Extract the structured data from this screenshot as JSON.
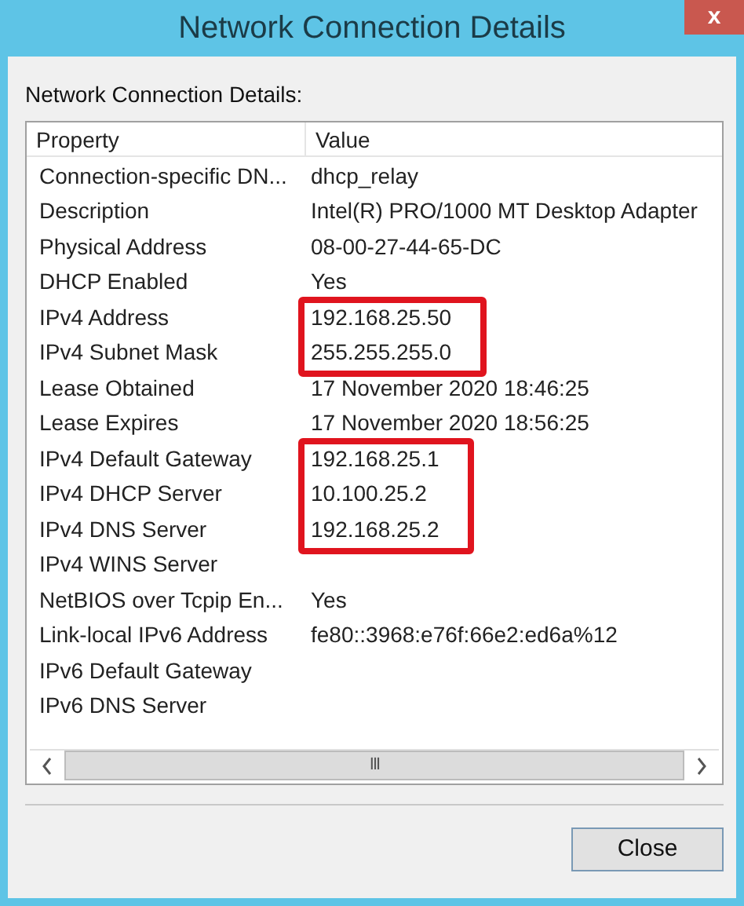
{
  "window": {
    "title": "Network Connection Details",
    "close_glyph": "x"
  },
  "label": "Network Connection Details:",
  "table": {
    "columns": [
      "Property",
      "Value"
    ],
    "rows": [
      {
        "property": "Connection-specific DN...",
        "value": "dhcp_relay",
        "highlighted": false
      },
      {
        "property": "Description",
        "value": "Intel(R) PRO/1000 MT Desktop Adapter",
        "highlighted": false
      },
      {
        "property": "Physical Address",
        "value": "08-00-27-44-65-DC",
        "highlighted": false
      },
      {
        "property": "DHCP Enabled",
        "value": "Yes",
        "highlighted": false
      },
      {
        "property": "IPv4 Address",
        "value": "192.168.25.50",
        "highlighted": true
      },
      {
        "property": "IPv4 Subnet Mask",
        "value": "255.255.255.0",
        "highlighted": true
      },
      {
        "property": "Lease Obtained",
        "value": "17 November 2020 18:46:25",
        "highlighted": false
      },
      {
        "property": "Lease Expires",
        "value": "17 November 2020 18:56:25",
        "highlighted": false
      },
      {
        "property": "IPv4 Default Gateway",
        "value": "192.168.25.1",
        "highlighted": true
      },
      {
        "property": "IPv4 DHCP Server",
        "value": "10.100.25.2",
        "highlighted": true
      },
      {
        "property": "IPv4 DNS Server",
        "value": "192.168.25.2",
        "highlighted": true
      },
      {
        "property": "IPv4 WINS Server",
        "value": "",
        "highlighted": false
      },
      {
        "property": "NetBIOS over Tcpip En...",
        "value": "Yes",
        "highlighted": false
      },
      {
        "property": "Link-local IPv6 Address",
        "value": "fe80::3968:e76f:66e2:ed6a%12",
        "highlighted": false
      },
      {
        "property": "IPv6 Default Gateway",
        "value": "",
        "highlighted": false
      },
      {
        "property": "IPv6 DNS Server",
        "value": "",
        "highlighted": false
      }
    ]
  },
  "scrollbar": {
    "thumb_grip": "III"
  },
  "buttons": [
    {
      "label": "Close"
    }
  ]
}
